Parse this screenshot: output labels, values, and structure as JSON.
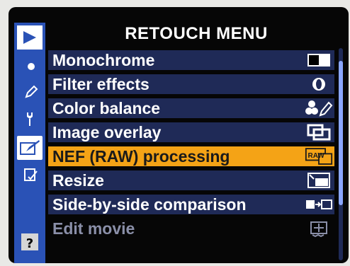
{
  "title": "RETOUCH MENU",
  "menu_items": [
    {
      "label": "Monochrome",
      "icon": "monochrome-icon"
    },
    {
      "label": "Filter effects",
      "icon": "filter-effects-icon"
    },
    {
      "label": "Color balance",
      "icon": "color-balance-icon"
    },
    {
      "label": "Image overlay",
      "icon": "image-overlay-icon"
    },
    {
      "label": "NEF (RAW) processing",
      "icon": "raw-processing-icon"
    },
    {
      "label": "Resize",
      "icon": "resize-icon"
    },
    {
      "label": "Side-by-side comparison",
      "icon": "side-by-side-icon"
    },
    {
      "label": "Edit movie",
      "icon": "edit-movie-icon"
    }
  ],
  "selected_index": 4,
  "raw_icon_text": "RAW",
  "help_symbol": "?",
  "colors": {
    "rail": "#2a52b6",
    "row_bg": "#1f2a57",
    "selected": "#f4a316"
  }
}
